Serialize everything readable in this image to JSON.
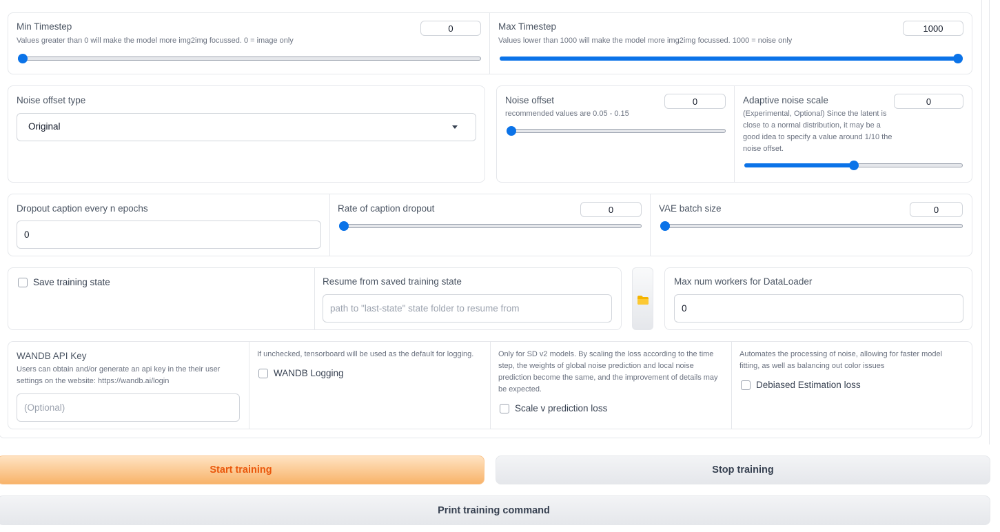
{
  "timestep": {
    "min": {
      "label": "Min Timestep",
      "info": "Values greater than 0 will make the model more img2img focussed. 0 = image only",
      "value": "0",
      "fraction": 0
    },
    "max": {
      "label": "Max Timestep",
      "info": "Values lower than 1000 will make the model more img2img focussed. 1000 = noise only",
      "value": "1000",
      "fraction": 1
    }
  },
  "noise": {
    "type_label": "Noise offset type",
    "type_value": "Original",
    "offset": {
      "label": "Noise offset",
      "info": "recommended values are 0.05 - 0.15",
      "value": "0",
      "fraction": 0
    },
    "adaptive": {
      "label": "Adaptive noise scale",
      "info": "(Experimental, Optional) Since the latent is close to a normal distribution, it may be a good idea to specify a value around 1/10 the noise offset.",
      "value": "0",
      "fraction": 0.5
    }
  },
  "dropout": {
    "every_n": {
      "label": "Dropout caption every n epochs",
      "value": "0"
    },
    "rate": {
      "label": "Rate of caption dropout",
      "value": "0",
      "fraction": 0
    },
    "vae": {
      "label": "VAE batch size",
      "value": "0",
      "fraction": 0
    }
  },
  "state": {
    "save_label": "Save training state",
    "resume_label": "Resume from saved training state",
    "resume_placeholder": "path to \"last-state\" state folder to resume from",
    "folder_icon": "folder-icon",
    "workers_label": "Max num workers for DataLoader",
    "workers_value": "0"
  },
  "logging": {
    "wandb_label": "WANDB API Key",
    "wandb_info": "Users can obtain and/or generate an api key in the their user settings on the website: https://wandb.ai/login",
    "wandb_placeholder": "(Optional)",
    "wandb_logging_info": "If unchecked, tensorboard will be used as the default for logging.",
    "wandb_logging_label": "WANDB Logging",
    "scale_v_info": "Only for SD v2 models. By scaling the loss according to the time step, the weights of global noise prediction and local noise prediction become the same, and the improvement of details may be expected.",
    "scale_v_label": "Scale v prediction loss",
    "debiased_info": "Automates the processing of noise, allowing for faster model fitting, as well as balancing out color issues",
    "debiased_label": "Debiased Estimation loss"
  },
  "buttons": {
    "start": "Start training",
    "stop": "Stop training",
    "print": "Print training command"
  },
  "colors": {
    "accent": "#0b73e8",
    "primary_text": "#ea580c"
  }
}
